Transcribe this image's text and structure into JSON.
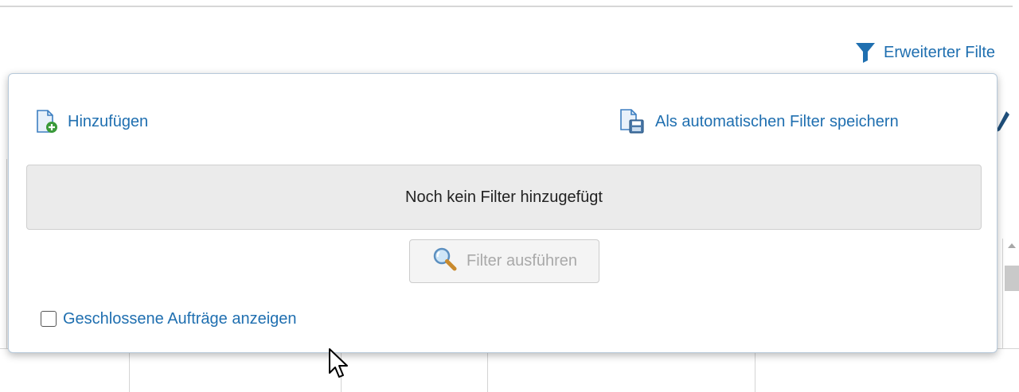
{
  "header": {
    "extended_filter_label": "Erweiterter Filte",
    "filter_icon": "funnel-icon"
  },
  "popup": {
    "add_label": "Hinzufügen",
    "add_icon": "document-add-icon",
    "save_label": "Als automatischen Filter speichern",
    "save_icon": "document-save-icon",
    "empty_message": "Noch kein Filter hinzugefügt",
    "run_button_label": "Filter ausführen",
    "run_button_icon": "magnifier-icon",
    "run_button_enabled": false,
    "show_closed_label": "Geschlossene Aufträge anzeigen",
    "show_closed_checked": false
  },
  "colors": {
    "link": "#1f6fb0",
    "disabled_text": "#a9a9a9",
    "empty_box_bg": "#ebebeb"
  }
}
